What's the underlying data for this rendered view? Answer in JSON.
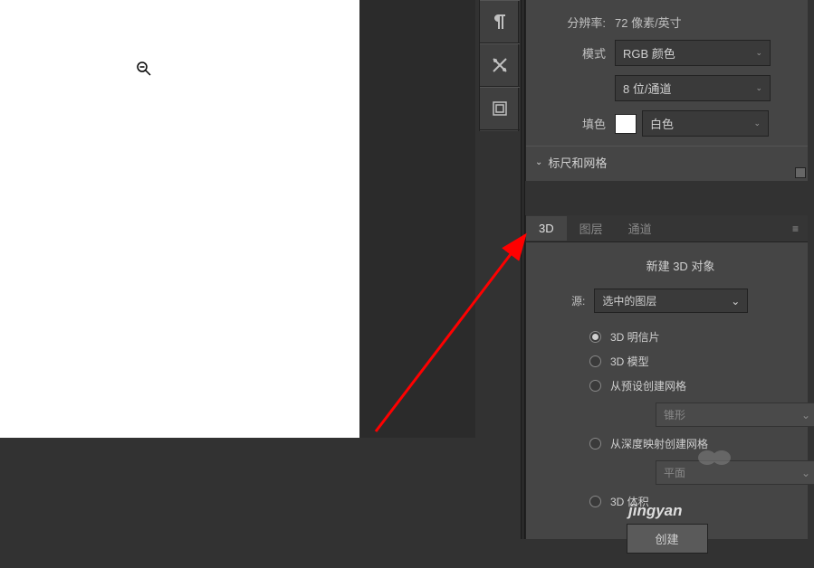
{
  "properties": {
    "resolution_label": "分辨率:",
    "resolution_value": "72 像素/英寸",
    "mode_label": "模式",
    "mode_value": "RGB 颜色",
    "depth_value": "8 位/通道",
    "fill_label": "填色",
    "fill_value": "白色",
    "rulers_section": "标尺和网格"
  },
  "tabs": {
    "t3d": "3D",
    "layers": "图层",
    "channels": "通道"
  },
  "panel3d": {
    "title": "新建 3D 对象",
    "source_label": "源:",
    "source_value": "选中的图层",
    "options": {
      "postcard": "3D 明信片",
      "model": "3D 模型",
      "preset_mesh": "从预设创建网格",
      "preset_value": "锥形",
      "depth_map": "从深度映射创建网格",
      "depth_value": "平面",
      "volume": "3D 体积"
    },
    "create_btn": "创建"
  },
  "watermark": "jingyan"
}
